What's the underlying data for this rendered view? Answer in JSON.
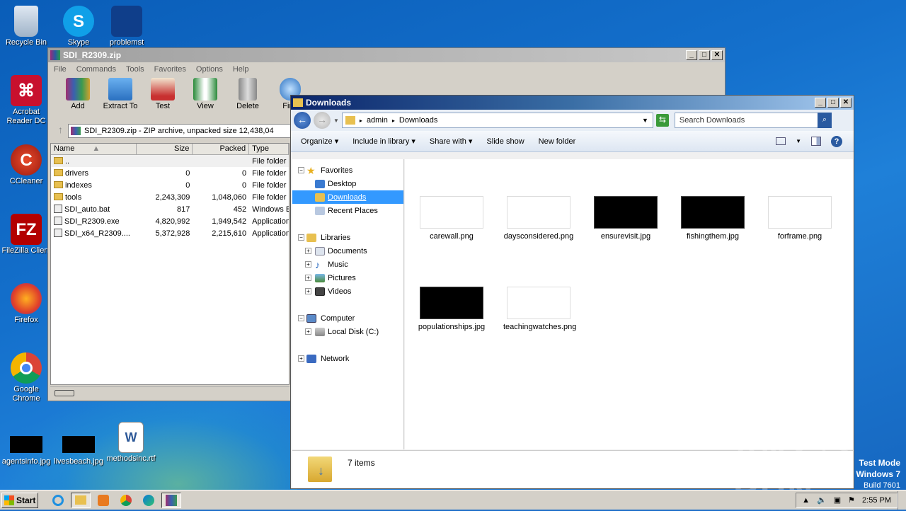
{
  "desktop": {
    "icons": [
      {
        "label": "Recycle Bin"
      },
      {
        "label": "Skype"
      },
      {
        "label": "problemst"
      },
      {
        "label": "Acrobat Reader DC"
      },
      {
        "label": "CCleaner"
      },
      {
        "label": "FileZilla Client"
      },
      {
        "label": "Firefox"
      },
      {
        "label": "Google Chrome"
      },
      {
        "label": "agentsinfo.jpg"
      },
      {
        "label": "livesbeach.jpg"
      },
      {
        "label": "methodsinc.rtf"
      }
    ]
  },
  "winrar": {
    "title": "SDI_R2309.zip",
    "menu": [
      "File",
      "Commands",
      "Tools",
      "Favorites",
      "Options",
      "Help"
    ],
    "toolbar": [
      "Add",
      "Extract To",
      "Test",
      "View",
      "Delete",
      "Find"
    ],
    "address": "SDI_R2309.zip - ZIP archive, unpacked size 12,438,04",
    "columns": [
      "Name",
      "Size",
      "Packed",
      "Type"
    ],
    "rows": [
      {
        "name": "..",
        "size": "",
        "packed": "",
        "type": "File folder"
      },
      {
        "name": "drivers",
        "size": "0",
        "packed": "0",
        "type": "File folder"
      },
      {
        "name": "indexes",
        "size": "0",
        "packed": "0",
        "type": "File folder"
      },
      {
        "name": "tools",
        "size": "2,243,309",
        "packed": "1,048,060",
        "type": "File folder"
      },
      {
        "name": "SDI_auto.bat",
        "size": "817",
        "packed": "452",
        "type": "Windows E"
      },
      {
        "name": "SDI_R2309.exe",
        "size": "4,820,992",
        "packed": "1,949,542",
        "type": "Application"
      },
      {
        "name": "SDI_x64_R2309....",
        "size": "5,372,928",
        "packed": "2,215,610",
        "type": "Application"
      }
    ]
  },
  "explorer": {
    "title": "Downloads",
    "path": [
      "admin",
      "Downloads"
    ],
    "search_placeholder": "Search Downloads",
    "commands": [
      "Organize",
      "Include in library",
      "Share with",
      "Slide show",
      "New folder"
    ],
    "nav": {
      "favorites": "Favorites",
      "desktop": "Desktop",
      "downloads": "Downloads",
      "recent": "Recent Places",
      "libraries": "Libraries",
      "documents": "Documents",
      "music": "Music",
      "pictures": "Pictures",
      "videos": "Videos",
      "computer": "Computer",
      "localdisk": "Local Disk (C:)",
      "network": "Network"
    },
    "files": [
      {
        "name": "carewall.png",
        "dark": false
      },
      {
        "name": "daysconsidered.png",
        "dark": false
      },
      {
        "name": "ensurevisit.jpg",
        "dark": true
      },
      {
        "name": "fishingthem.jpg",
        "dark": true
      },
      {
        "name": "forframe.png",
        "dark": false
      },
      {
        "name": "populationships.jpg",
        "dark": true
      },
      {
        "name": "teachingwatches.png",
        "dark": false
      }
    ],
    "status": "7 items"
  },
  "taskbar": {
    "start": "Start",
    "time": "2:55 PM"
  },
  "watermark": {
    "line1": "Test Mode",
    "line2": "Windows 7",
    "line3": "Build 7601",
    "brand": "ANY RUN"
  }
}
